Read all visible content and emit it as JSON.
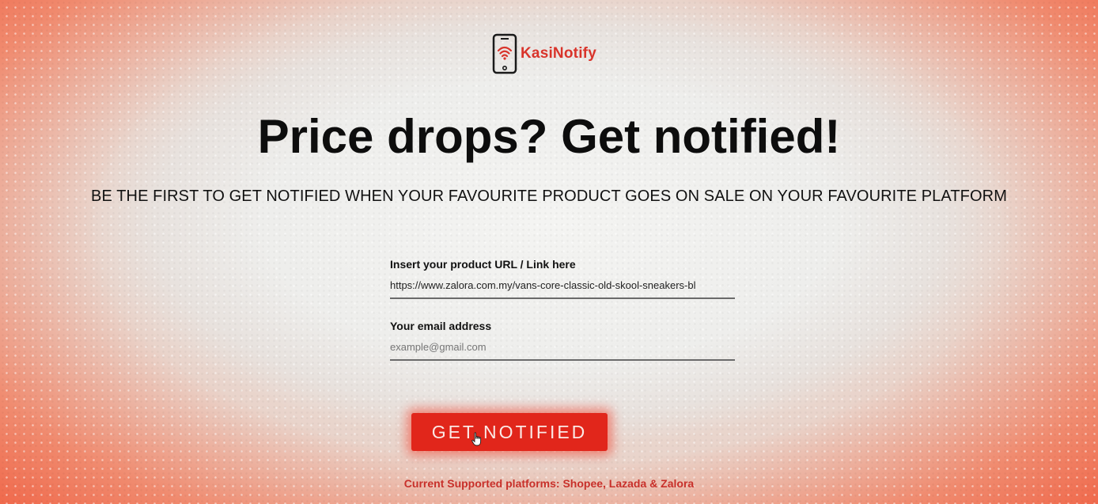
{
  "brand": {
    "name": "KasiNotify",
    "icon": "phone-wifi-icon",
    "color": "#d9342b"
  },
  "hero": {
    "headline": "Price drops? Get notified!",
    "subheadline": "BE THE FIRST TO GET NOTIFIED WHEN YOUR FAVOURITE PRODUCT GOES ON SALE ON YOUR FAVOURITE PLATFORM"
  },
  "form": {
    "url_label": "Insert your product URL / Link here",
    "url_value": "https://www.zalora.com.my/vans-core-classic-old-skool-sneakers-bl",
    "email_label": "Your email address",
    "email_placeholder": "example@gmail.com",
    "submit_label": "GET NOTIFIED"
  },
  "footer": {
    "supported_platforms": "Current Supported platforms: Shopee, Lazada & Zalora"
  },
  "colors": {
    "accent": "#e1261b",
    "edge_glow": "#f05a3c",
    "background_center": "#eeeeec"
  }
}
